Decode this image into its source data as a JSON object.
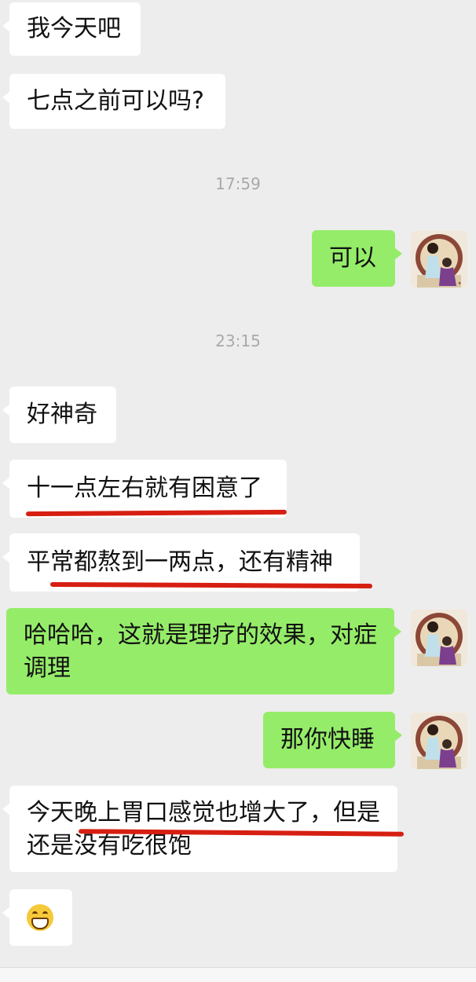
{
  "messages": {
    "m1": "我今天吧",
    "m2": "七点之前可以吗?",
    "t1": "17:59",
    "m3": "可以",
    "t2": "23:15",
    "m4": "好神奇",
    "m5": "十一点左右就有困意了",
    "m6": "平常都熬到一两点，还有精神",
    "m7": "哈哈哈，这就是理疗的效果，对症调理",
    "m8": "那你快睡",
    "m9": "今天晚上胃口感觉也增大了，但是还是没有吃很饱"
  },
  "colors": {
    "incoming_bubble": "#ffffff",
    "outgoing_bubble": "#95ec69",
    "background": "#ededed",
    "annotation": "#d61f12"
  },
  "icons": {
    "avatar": "avatar-portrait-icon",
    "emoji": "grinning-emoji-icon"
  }
}
